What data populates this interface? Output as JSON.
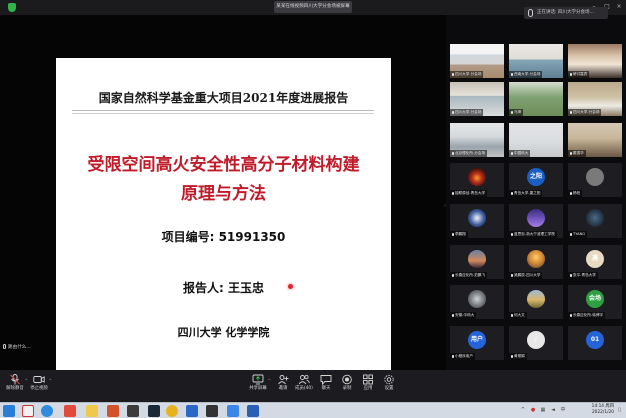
{
  "window": {
    "title": "某某在线视频四川大学分会场被屏幕"
  },
  "speaking": {
    "label": "正在讲话: 四川大学分会场..."
  },
  "slide": {
    "title": "国家自然科学基金重大项目2021年度进展报告",
    "heading_line1": "受限空间高火安全性高分子材料构建",
    "heading_line2": "原理与方法",
    "project_code": "项目编号:  51991350",
    "presenter": "报告人: 王玉忠",
    "institution": "四川大学 化学学院"
  },
  "self_preview": {
    "label": "路由什么..."
  },
  "participants": [
    {
      "name": "四川大学-分会场",
      "kind": "video",
      "style": "v1"
    },
    {
      "name": "西南大学-分会场",
      "kind": "video",
      "style": "v2"
    },
    {
      "name": "研讨嘉宾",
      "kind": "video",
      "style": "v3"
    },
    {
      "name": "四川大学-分会场",
      "kind": "video",
      "style": "v4"
    },
    {
      "name": "马坤",
      "kind": "video",
      "style": "v5"
    },
    {
      "name": "四川大学-分会场",
      "kind": "video",
      "style": "v6"
    },
    {
      "name": "北京理化所-分会场",
      "kind": "video",
      "style": "v7"
    },
    {
      "name": "中国科大",
      "kind": "video",
      "style": "v8"
    },
    {
      "name": "戴振华",
      "kind": "video",
      "style": "v9"
    },
    {
      "name": "独联原创-青岛大学",
      "kind": "avatar",
      "style": "a-fire",
      "text": ""
    },
    {
      "name": "青岛大学-唐之阳",
      "kind": "avatar",
      "style": "a-blue",
      "text": "之阳"
    },
    {
      "name": "杨柏",
      "kind": "avatar",
      "style": "a-gray",
      "text": ""
    },
    {
      "name": "李鹏翔",
      "kind": "avatar",
      "style": "a-flower",
      "text": ""
    },
    {
      "name": "蓝思忠-浙大宁波理工学院",
      "kind": "avatar",
      "style": "a-purple",
      "text": ""
    },
    {
      "name": "TYANG",
      "kind": "avatar",
      "style": "a-dark",
      "text": ""
    },
    {
      "name": "长春应化所-范鹏飞",
      "kind": "avatar",
      "style": "a-dusk",
      "text": ""
    },
    {
      "name": "吴鹏辰-四川大学",
      "kind": "avatar",
      "style": "a-sun",
      "text": ""
    },
    {
      "name": "张平-青岛大学",
      "kind": "avatar",
      "style": "a-beige",
      "text": "遇"
    },
    {
      "name": "安徽-中科大",
      "kind": "avatar",
      "style": "a-moon",
      "text": ""
    },
    {
      "name": "何大文",
      "kind": "avatar",
      "style": "a-field",
      "text": ""
    },
    {
      "name": "长春应化所-徐博宇",
      "kind": "avatar",
      "style": "a-green",
      "text": "会场"
    },
    {
      "name": "小程序用户",
      "kind": "avatar",
      "style": "a-blue2",
      "text": "用户"
    },
    {
      "name": "黄丽娟",
      "kind": "avatar",
      "style": "a-white",
      "text": "♪"
    },
    {
      "name": "",
      "kind": "avatar",
      "style": "a-blue2",
      "text": "01"
    }
  ],
  "toolbar": {
    "left": [
      {
        "label": "解除静音",
        "icon": "mic-muted-icon"
      },
      {
        "label": "停止视频",
        "icon": "video-icon"
      }
    ],
    "center": [
      {
        "label": "共享屏幕",
        "icon": "share-screen-icon"
      },
      {
        "label": "邀请",
        "icon": "invite-icon"
      },
      {
        "label": "成员(40)",
        "icon": "members-icon"
      },
      {
        "label": "聊天",
        "icon": "chat-icon"
      },
      {
        "label": "录制",
        "icon": "record-icon"
      },
      {
        "label": "应用",
        "icon": "apps-icon"
      },
      {
        "label": "设置",
        "icon": "settings-icon"
      }
    ]
  },
  "taskbar": {
    "time": "14:14 周四",
    "date": "2022/1/20"
  }
}
